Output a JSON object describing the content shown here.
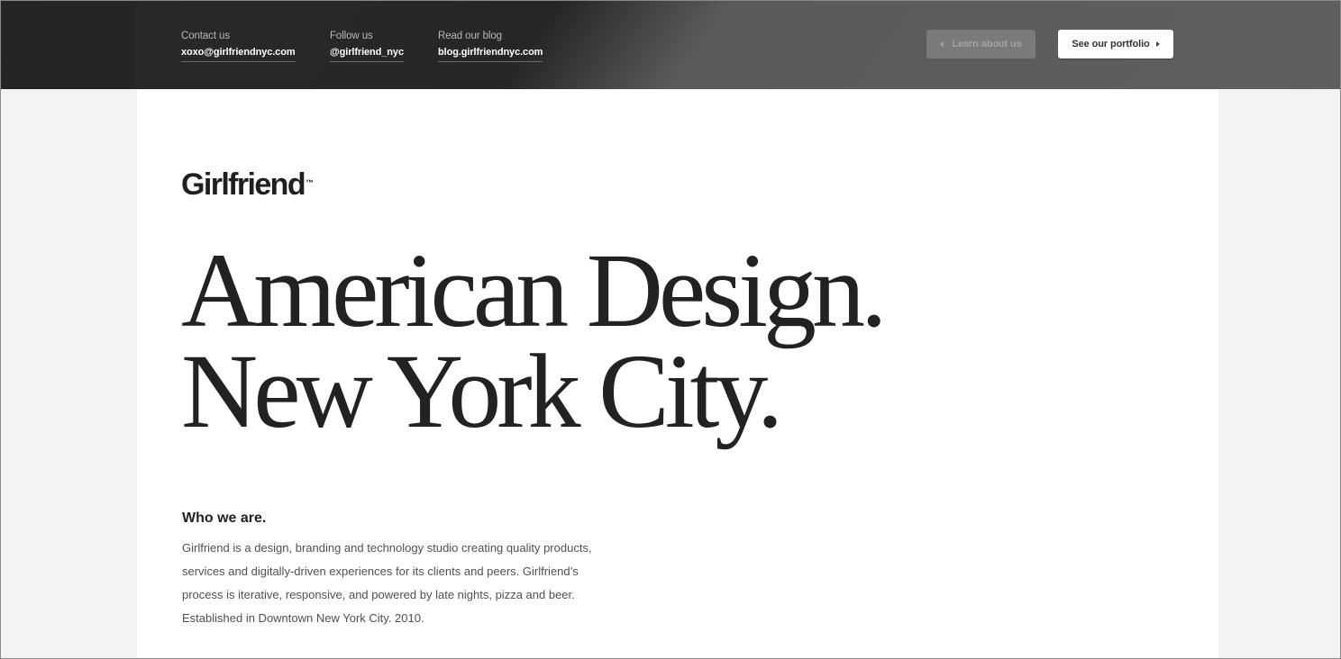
{
  "header": {
    "contact": {
      "label": "Contact us",
      "value": "xoxo@girlfriendnyc.com"
    },
    "follow": {
      "label": "Follow us",
      "value": "@girlfriend_nyc"
    },
    "blog": {
      "label": "Read our blog",
      "value": "blog.girlfriendnyc.com"
    },
    "learn_button": "Learn about us",
    "portfolio_button": "See our portfolio"
  },
  "brand": {
    "name": "Girlfriend",
    "trademark": "™"
  },
  "hero": {
    "line1": "American Design.",
    "line2": "New York City."
  },
  "about": {
    "title": "Who we are.",
    "lines": [
      "Girlfriend is a design, branding and technology studio creating quality products,",
      "services and digitally-driven experiences for its clients and peers. Girlfriend’s",
      "process is iterative, responsive, and powered by late nights, pizza and beer.",
      "Established in Downtown New York City. 2010."
    ]
  },
  "colors": {
    "topbar": "#2a2a2a",
    "text_dark": "#222222",
    "body_text": "#505050",
    "page_bg": "#f3f3f3",
    "content_bg": "#ffffff"
  },
  "icons": {
    "learn_arrow": "triangle-left",
    "portfolio_arrow": "triangle-right"
  }
}
